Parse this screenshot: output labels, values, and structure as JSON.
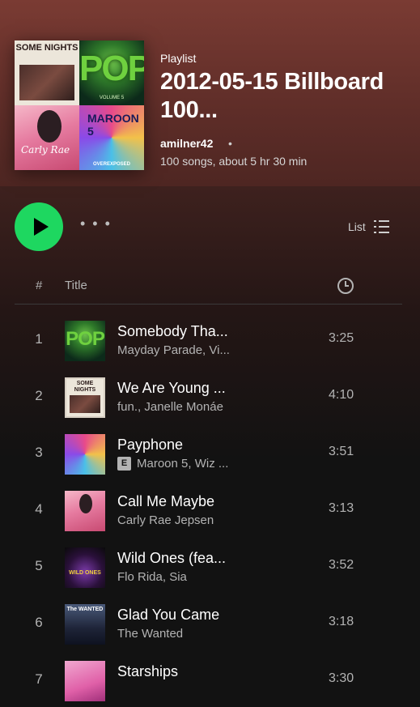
{
  "header": {
    "type_label": "Playlist",
    "title": "2012-05-15 Billboard 100...",
    "owner": "amilner42",
    "separator": "•",
    "meta": "100 songs, about 5 hr 30 min",
    "cover_tiles": [
      {
        "label": "SOME NIGHTS"
      },
      {
        "label": "POP",
        "sub": "VOLUME 5"
      },
      {
        "label": "Carly Rae"
      },
      {
        "label": "MAROON 5",
        "sub": "OVEREXPOSED"
      }
    ]
  },
  "controls": {
    "play_icon": "play-icon",
    "more_label": "• • •",
    "view_label": "List",
    "view_icon": "list-icon"
  },
  "table": {
    "headers": {
      "num": "#",
      "title": "Title",
      "duration_icon": "clock-icon"
    },
    "rows": [
      {
        "num": "1",
        "title": "Somebody Tha...",
        "artist": "Mayday Parade, Vi...",
        "duration": "3:25",
        "explicit": false
      },
      {
        "num": "2",
        "title": "We Are Young ...",
        "artist": "fun., Janelle Monáe",
        "duration": "4:10",
        "explicit": false
      },
      {
        "num": "3",
        "title": "Payphone",
        "artist": "Maroon 5, Wiz ...",
        "duration": "3:51",
        "explicit": true
      },
      {
        "num": "4",
        "title": "Call Me Maybe",
        "artist": "Carly Rae Jepsen",
        "duration": "3:13",
        "explicit": false
      },
      {
        "num": "5",
        "title": "Wild Ones (fea...",
        "artist": "Flo Rida, Sia",
        "duration": "3:52",
        "explicit": false
      },
      {
        "num": "6",
        "title": "Glad You Came",
        "artist": "The Wanted",
        "duration": "3:18",
        "explicit": false
      },
      {
        "num": "7",
        "title": "Starships",
        "artist": "",
        "duration": "3:30",
        "explicit": false
      }
    ],
    "explicit_badge": "E"
  },
  "colors": {
    "accent_green": "#1ed760",
    "header_bg": "#7a3b33",
    "page_bg": "#121212",
    "muted_text": "#b3b3b3"
  }
}
